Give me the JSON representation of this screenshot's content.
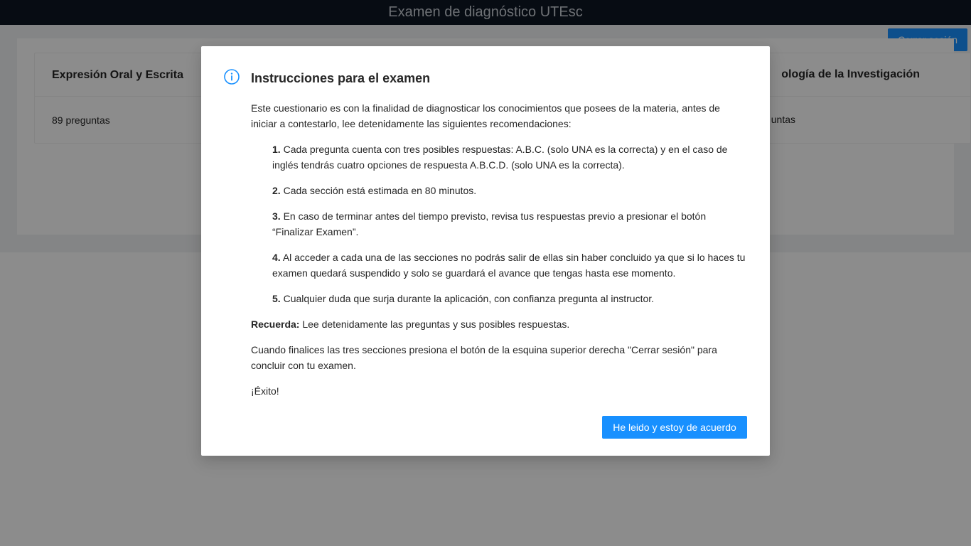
{
  "header": {
    "title": "Examen de diagnóstico UTEsc",
    "logout_label": "Cerrar sesión"
  },
  "sections": [
    {
      "title": "Expresión Oral y Escrita",
      "subtitle": "89 preguntas"
    },
    {
      "title": "ología de la Investigación",
      "subtitle": "untas"
    }
  ],
  "modal": {
    "title": "Instrucciones para el examen",
    "intro": "Este cuestionario es con la finalidad de diagnosticar los conocimientos que posees de la materia, antes de iniciar a contestarlo, lee detenidamente las siguientes recomendaciones:",
    "items": [
      {
        "num": "1.",
        "text": "Cada pregunta cuenta con tres posibles respuestas: A.B.C. (solo UNA es la correcta) y en el caso de inglés tendrás cuatro opciones de respuesta A.B.C.D. (solo UNA es la correcta)."
      },
      {
        "num": "2.",
        "text": "Cada sección está estimada en 80 minutos."
      },
      {
        "num": "3.",
        "text": "En caso de terminar antes del tiempo previsto, revisa tus respuestas previo a presionar el botón “Finalizar Examen”."
      },
      {
        "num": "4.",
        "text": "Al acceder a cada una de las secciones no podrás salir de ellas sin haber concluido ya que si lo haces tu examen quedará suspendido y solo se guardará el avance que tengas hasta ese momento."
      },
      {
        "num": "5.",
        "text": "Cualquier duda que surja durante la aplicación, con confianza pregunta al instructor."
      }
    ],
    "reminder_label": "Recuerda:",
    "reminder_text": "Lee detenidamente las preguntas y sus posibles respuestas.",
    "closing": "Cuando finalices las tres secciones presiona el botón de la esquina superior derecha \"Cerrar sesión\" para concluir con tu examen.",
    "farewell": "¡Éxito!",
    "accept_label": "He leido y estoy de acuerdo"
  },
  "colors": {
    "primary": "#1890ff",
    "topbar": "#0e1724",
    "info_icon": "#1890ff"
  },
  "icons": {
    "modal_icon": "info-circle-icon"
  }
}
